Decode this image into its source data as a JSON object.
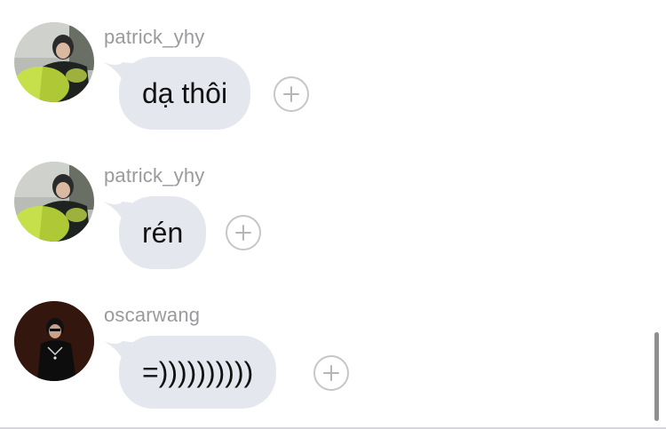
{
  "messages": [
    {
      "username": "patrick_yhy",
      "text": "dạ thôi",
      "avatar": "patrick-avatar"
    },
    {
      "username": "patrick_yhy",
      "text": "rén",
      "avatar": "patrick-avatar"
    },
    {
      "username": "oscarwang",
      "text": "=))))))))))",
      "avatar": "oscarwang-avatar"
    }
  ],
  "icons": {
    "react": "plus-circle-icon"
  },
  "colors": {
    "bubble": "#e4e7ed",
    "username": "#9a9a9e",
    "text": "#111111",
    "react_border": "#c6c6c8"
  }
}
